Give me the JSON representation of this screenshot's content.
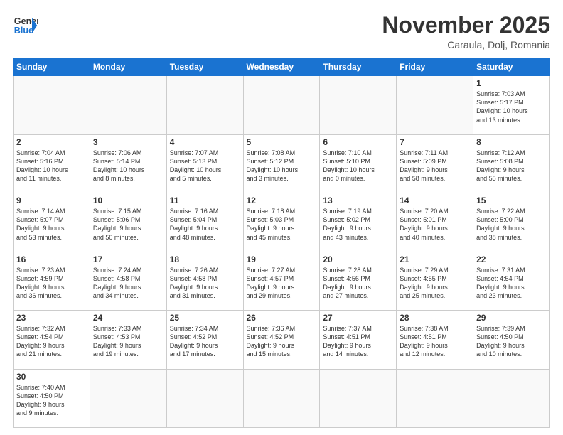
{
  "header": {
    "logo_general": "General",
    "logo_blue": "Blue",
    "month_title": "November 2025",
    "location": "Caraula, Dolj, Romania"
  },
  "weekdays": [
    "Sunday",
    "Monday",
    "Tuesday",
    "Wednesday",
    "Thursday",
    "Friday",
    "Saturday"
  ],
  "weeks": [
    [
      {
        "day": null
      },
      {
        "day": null
      },
      {
        "day": null
      },
      {
        "day": null
      },
      {
        "day": null
      },
      {
        "day": null
      },
      {
        "day": "1",
        "info": "Sunrise: 7:03 AM\nSunset: 5:17 PM\nDaylight: 10 hours\nand 13 minutes."
      }
    ],
    [
      {
        "day": "2",
        "info": "Sunrise: 7:04 AM\nSunset: 5:16 PM\nDaylight: 10 hours\nand 11 minutes."
      },
      {
        "day": "3",
        "info": "Sunrise: 7:06 AM\nSunset: 5:14 PM\nDaylight: 10 hours\nand 8 minutes."
      },
      {
        "day": "4",
        "info": "Sunrise: 7:07 AM\nSunset: 5:13 PM\nDaylight: 10 hours\nand 5 minutes."
      },
      {
        "day": "5",
        "info": "Sunrise: 7:08 AM\nSunset: 5:12 PM\nDaylight: 10 hours\nand 3 minutes."
      },
      {
        "day": "6",
        "info": "Sunrise: 7:10 AM\nSunset: 5:10 PM\nDaylight: 10 hours\nand 0 minutes."
      },
      {
        "day": "7",
        "info": "Sunrise: 7:11 AM\nSunset: 5:09 PM\nDaylight: 9 hours\nand 58 minutes."
      },
      {
        "day": "8",
        "info": "Sunrise: 7:12 AM\nSunset: 5:08 PM\nDaylight: 9 hours\nand 55 minutes."
      }
    ],
    [
      {
        "day": "9",
        "info": "Sunrise: 7:14 AM\nSunset: 5:07 PM\nDaylight: 9 hours\nand 53 minutes."
      },
      {
        "day": "10",
        "info": "Sunrise: 7:15 AM\nSunset: 5:06 PM\nDaylight: 9 hours\nand 50 minutes."
      },
      {
        "day": "11",
        "info": "Sunrise: 7:16 AM\nSunset: 5:04 PM\nDaylight: 9 hours\nand 48 minutes."
      },
      {
        "day": "12",
        "info": "Sunrise: 7:18 AM\nSunset: 5:03 PM\nDaylight: 9 hours\nand 45 minutes."
      },
      {
        "day": "13",
        "info": "Sunrise: 7:19 AM\nSunset: 5:02 PM\nDaylight: 9 hours\nand 43 minutes."
      },
      {
        "day": "14",
        "info": "Sunrise: 7:20 AM\nSunset: 5:01 PM\nDaylight: 9 hours\nand 40 minutes."
      },
      {
        "day": "15",
        "info": "Sunrise: 7:22 AM\nSunset: 5:00 PM\nDaylight: 9 hours\nand 38 minutes."
      }
    ],
    [
      {
        "day": "16",
        "info": "Sunrise: 7:23 AM\nSunset: 4:59 PM\nDaylight: 9 hours\nand 36 minutes."
      },
      {
        "day": "17",
        "info": "Sunrise: 7:24 AM\nSunset: 4:58 PM\nDaylight: 9 hours\nand 34 minutes."
      },
      {
        "day": "18",
        "info": "Sunrise: 7:26 AM\nSunset: 4:58 PM\nDaylight: 9 hours\nand 31 minutes."
      },
      {
        "day": "19",
        "info": "Sunrise: 7:27 AM\nSunset: 4:57 PM\nDaylight: 9 hours\nand 29 minutes."
      },
      {
        "day": "20",
        "info": "Sunrise: 7:28 AM\nSunset: 4:56 PM\nDaylight: 9 hours\nand 27 minutes."
      },
      {
        "day": "21",
        "info": "Sunrise: 7:29 AM\nSunset: 4:55 PM\nDaylight: 9 hours\nand 25 minutes."
      },
      {
        "day": "22",
        "info": "Sunrise: 7:31 AM\nSunset: 4:54 PM\nDaylight: 9 hours\nand 23 minutes."
      }
    ],
    [
      {
        "day": "23",
        "info": "Sunrise: 7:32 AM\nSunset: 4:54 PM\nDaylight: 9 hours\nand 21 minutes."
      },
      {
        "day": "24",
        "info": "Sunrise: 7:33 AM\nSunset: 4:53 PM\nDaylight: 9 hours\nand 19 minutes."
      },
      {
        "day": "25",
        "info": "Sunrise: 7:34 AM\nSunset: 4:52 PM\nDaylight: 9 hours\nand 17 minutes."
      },
      {
        "day": "26",
        "info": "Sunrise: 7:36 AM\nSunset: 4:52 PM\nDaylight: 9 hours\nand 15 minutes."
      },
      {
        "day": "27",
        "info": "Sunrise: 7:37 AM\nSunset: 4:51 PM\nDaylight: 9 hours\nand 14 minutes."
      },
      {
        "day": "28",
        "info": "Sunrise: 7:38 AM\nSunset: 4:51 PM\nDaylight: 9 hours\nand 12 minutes."
      },
      {
        "day": "29",
        "info": "Sunrise: 7:39 AM\nSunset: 4:50 PM\nDaylight: 9 hours\nand 10 minutes."
      }
    ],
    [
      {
        "day": "30",
        "info": "Sunrise: 7:40 AM\nSunset: 4:50 PM\nDaylight: 9 hours\nand 9 minutes."
      },
      {
        "day": null
      },
      {
        "day": null
      },
      {
        "day": null
      },
      {
        "day": null
      },
      {
        "day": null
      },
      {
        "day": null
      }
    ]
  ]
}
